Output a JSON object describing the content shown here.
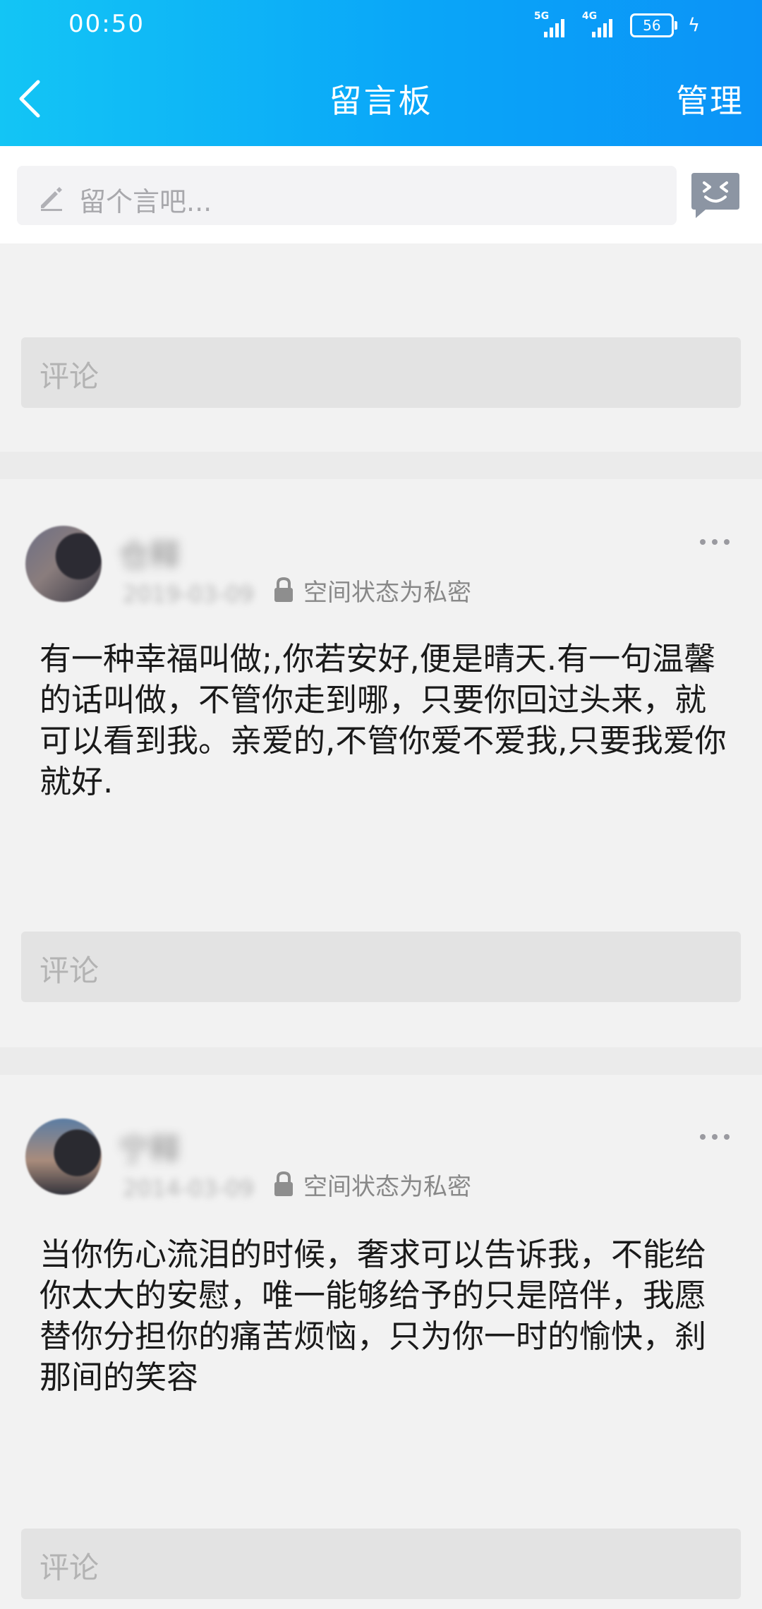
{
  "status_bar": {
    "time": "00:50",
    "net1": "5G",
    "net2": "4G",
    "battery": "56"
  },
  "header": {
    "title": "留言板",
    "manage_label": "管理"
  },
  "compose": {
    "placeholder": "留个言吧..."
  },
  "comment_placeholder": "评论",
  "posts": [
    {
      "username": "仓释",
      "date": "2019-03-09",
      "privacy": "空间状态为私密",
      "content": "有一种幸福叫做;,你若安好,便是晴天.有一句温馨的话叫做，不管你走到哪，只要你回过头来，就可以看到我。亲爱的,不管你爱不爱我,只要我爱你就好."
    },
    {
      "username": "宁释",
      "date": "2014-03-09",
      "privacy": "空间状态为私密",
      "content": "当你伤心流泪的时候，奢求可以告诉我，不能给你太大的安慰，唯一能够给予的只是陪伴，我愿替你分担你的痛苦烦恼，只为你一时的愉快，刹那间的笑容"
    }
  ],
  "colors": {
    "header_start": "#13c5f5",
    "header_end": "#0b93f7",
    "page_bg": "#ebebeb",
    "card_bg": "#f2f2f2",
    "comment_bg": "#e3e3e3"
  },
  "icons": {
    "back": "chevron-left-icon",
    "compose": "pencil-icon",
    "emoji": "emoji-face-icon",
    "privacy": "lock-icon",
    "more": "more-horizontal-icon"
  }
}
